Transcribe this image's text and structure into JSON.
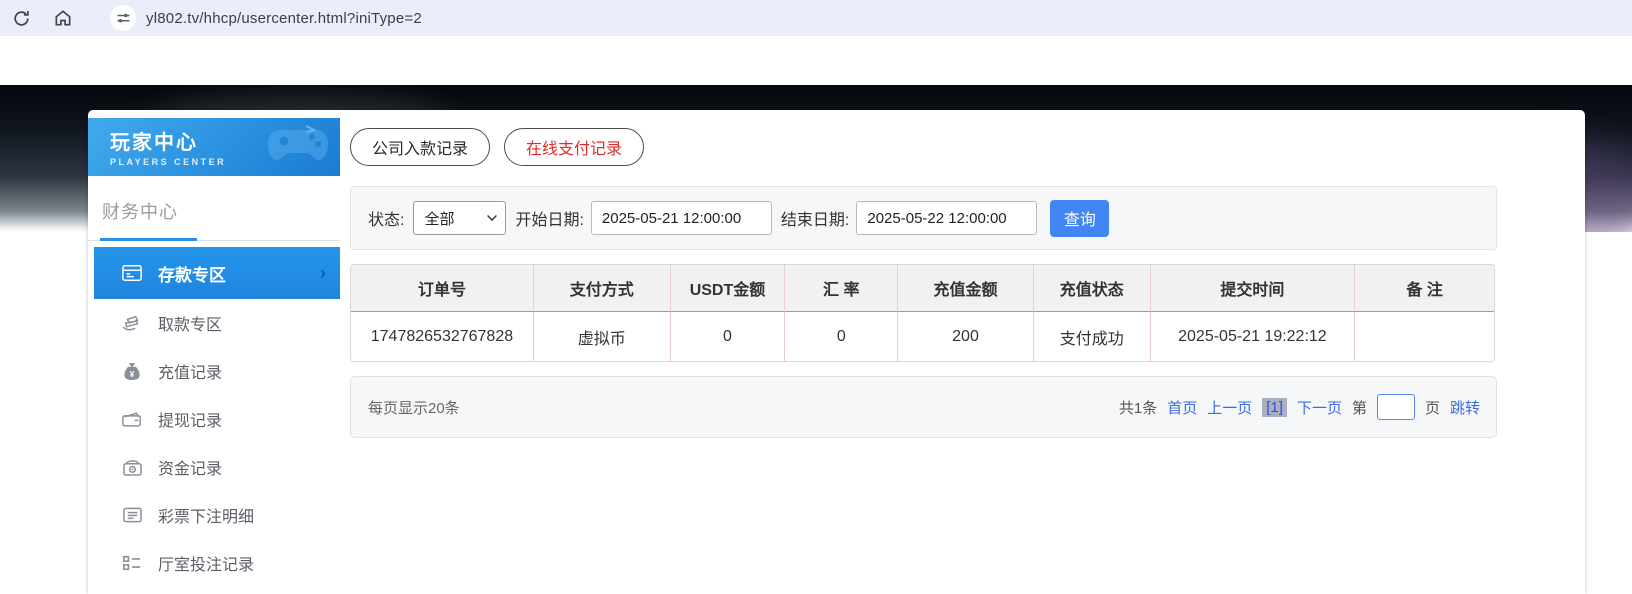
{
  "browser": {
    "url": "yl802.tv/hhcp/usercenter.html?iniType=2"
  },
  "sidebar": {
    "title": "玩家中心",
    "subtitle": "PLAYERS CENTER",
    "section": "财务中心",
    "items": [
      {
        "label": "存款专区",
        "icon": "deposit-card-icon",
        "active": true
      },
      {
        "label": "取款专区",
        "icon": "hand-money-icon",
        "active": false
      },
      {
        "label": "充值记录",
        "icon": "money-bag-icon",
        "active": false
      },
      {
        "label": "提现记录",
        "icon": "wallet-icon",
        "active": false
      },
      {
        "label": "资金记录",
        "icon": "purse-icon",
        "active": false
      },
      {
        "label": "彩票下注明细",
        "icon": "document-list-icon",
        "active": false
      },
      {
        "label": "厅室投注记录",
        "icon": "bullet-list-icon",
        "active": false
      }
    ]
  },
  "tabs": [
    {
      "label": "公司入款记录",
      "active": false
    },
    {
      "label": "在线支付记录",
      "active": true
    }
  ],
  "filters": {
    "status_label": "状态:",
    "status_value": "全部",
    "start_label": "开始日期:",
    "start_value": "2025-05-21 12:00:00",
    "end_label": "结束日期:",
    "end_value": "2025-05-22 12:00:00",
    "search_label": "查询"
  },
  "table": {
    "headers": [
      "订单号",
      "支付方式",
      "USDT金额",
      "汇 率",
      "充值金额",
      "充值状态",
      "提交时间",
      "备 注"
    ],
    "rows": [
      [
        "1747826532767828",
        "虚拟币",
        "0",
        "0",
        "200",
        "支付成功",
        "2025-05-21 19:22:12",
        ""
      ]
    ]
  },
  "pagination": {
    "page_size_text": "每页显示20条",
    "total_text": "共1条",
    "first_label": "首页",
    "prev_label": "上一页",
    "current_page": "[1]",
    "next_label": "下一页",
    "jump_prefix": "第",
    "jump_suffix": "页",
    "jump_label": "跳转",
    "jump_value": ""
  },
  "colors": {
    "accent_blue": "#2a8fe8",
    "search_button": "#4285f4",
    "link_blue": "#3a6be0",
    "active_tab_red": "#e02b2b",
    "sidebar_header_gradient_top": "#41aaec",
    "sidebar_header_gradient_bottom": "#1b7bd2",
    "table_divider_pink": "#eccdcd",
    "browser_bar": "#e9eefa"
  }
}
